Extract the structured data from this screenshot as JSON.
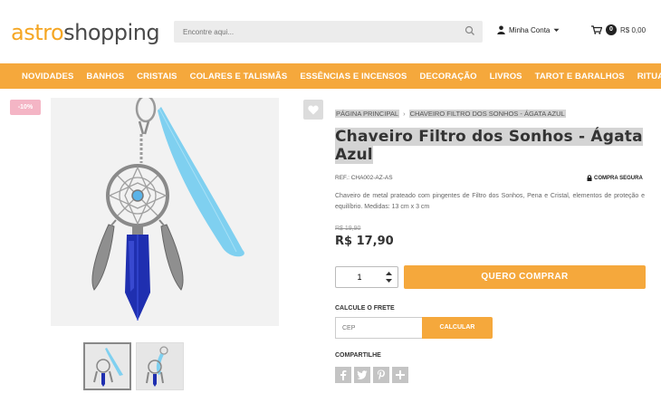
{
  "header": {
    "logo_part1": "astro",
    "logo_part2": "shopping",
    "search_placeholder": "Encontre aqui...",
    "account_label": "Minha Conta",
    "cart_count": "0",
    "cart_total": "R$ 0,00"
  },
  "nav": {
    "items": [
      "NOVIDADES",
      "BANHOS",
      "CRISTAIS",
      "COLARES E TALISMÃS",
      "ESSÊNCIAS E INCENSOS",
      "DECORAÇÃO",
      "LIVROS",
      "TAROT E BARALHOS",
      "RITUAIS"
    ]
  },
  "product": {
    "discount": "-10%",
    "breadcrumb": [
      "PÁGINA PRINCIPAL",
      "CHAVEIRO FILTRO DOS SONHOS - ÁGATA AZUL"
    ],
    "breadcrumb_sep": "›",
    "title": "Chaveiro Filtro dos Sonhos - Ágata Azul",
    "ref": "REF.: CHA002-AZ-AS",
    "secure": "COMPRA SEGURA",
    "description": "Chaveiro de metal prateado com pingentes de Filtro dos Sonhos, Pena e Cristal, elementos de proteção e equilíbrio. Medidas: 13 cm x 3 cm",
    "old_price": "R$ 19,90",
    "price": "R$ 17,90",
    "quantity": "1",
    "buy_label": "QUERO COMPRAR",
    "freight_label": "CALCULE O FRETE",
    "cep_placeholder": "CEP",
    "calc_label": "CALCULAR",
    "share_label": "COMPARTILHE"
  },
  "colors": {
    "accent": "#f5a83c",
    "discount_badge": "#f4b5c5",
    "feather": "#7fd0f0",
    "crystal": "#1f2fb0"
  }
}
